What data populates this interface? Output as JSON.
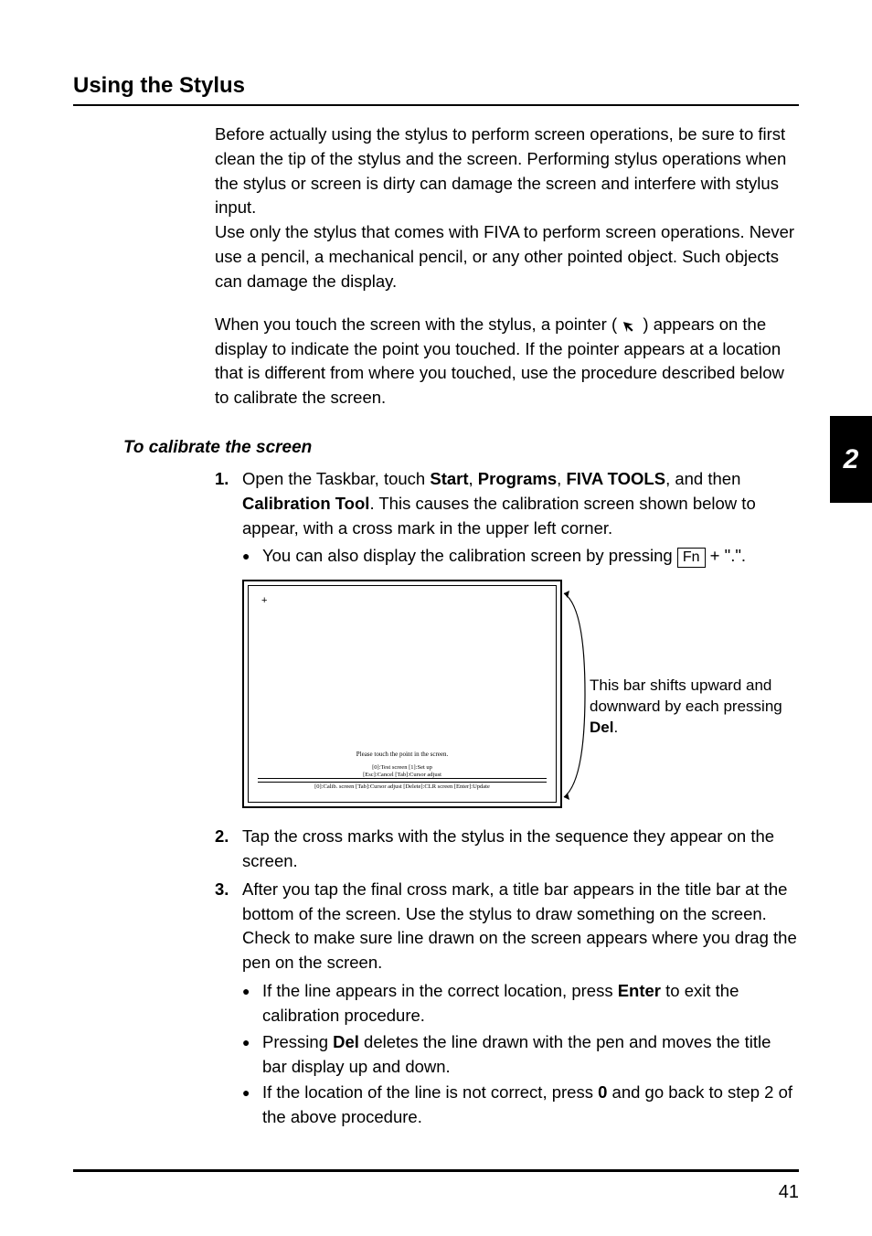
{
  "section_title": "Using the Stylus",
  "intro_p1_a": "Before actually using the stylus to perform screen operations, be sure to first clean the tip of the stylus and the screen. Performing stylus operations when the stylus or screen is dirty can damage the screen and interfere with stylus input.",
  "intro_p1_b": "Use only the stylus that comes with FIVA to perform screen operations. Never use a pencil, a mechanical pencil, or any other pointed object. Such objects can damage the display.",
  "intro_p2_a": "When you touch the screen with the stylus, a pointer ( ",
  "intro_p2_b": " ) appears on the display to indicate the point you touched. If the pointer appears at a location that is different from where you touched, use the procedure described below to calibrate the screen.",
  "subhead": "To calibrate the screen",
  "step1_num": "1.",
  "step1_a": "Open the Taskbar, touch ",
  "step1_b1": "Start",
  "step1_c": ", ",
  "step1_b2": "Programs",
  "step1_d": ", ",
  "step1_b3": "FIVA TOOLS",
  "step1_e": ", and then ",
  "step1_b4": "Calibration Tool",
  "step1_f": ". This causes the calibration screen shown below to appear, with a cross mark in the upper left corner.",
  "step1_bul_a": "You can also display the calibration screen by pressing ",
  "step1_fn": "Fn",
  "step1_bul_b": " + \".\".",
  "calib_prompt": "Please touch the point in the screen.",
  "calib_opts_l1": "[0]:Test screen   [1]:Set up",
  "calib_opts_l2": "[Esc]:Cancel      [Tab]:Cursor adjust",
  "calib_bar": "[0]:Calib. screen [Tab]:Cursor adjust [Delete]:CLR screen [Enter]:Update",
  "callout_a": "This bar shifts upward and downward by each pressing ",
  "callout_b": "Del",
  "callout_c": ".",
  "step2_num": "2.",
  "step2": "Tap the cross marks with the stylus in the sequence they appear on the screen.",
  "step3_num": "3.",
  "step3": "After you tap the final cross mark, a title bar appears in the title bar at the bottom of the screen. Use the stylus to draw something on the screen. Check to make sure line drawn on the screen appears where you drag the pen on the screen.",
  "step3_b1_a": "If the line appears in the correct location, press ",
  "step3_b1_k": "Enter",
  "step3_b1_b": " to exit the calibration procedure.",
  "step3_b2_a": "Pressing ",
  "step3_b2_k": "Del",
  "step3_b2_b": " deletes the line drawn with the pen and moves the title bar display up and down.",
  "step3_b3_a": "If the location of the line is not correct, press ",
  "step3_b3_k": "0",
  "step3_b3_b": " and go back to step 2 of the above procedure.",
  "chapter_num": "2",
  "page_number": "41",
  "cross_mark": "+"
}
